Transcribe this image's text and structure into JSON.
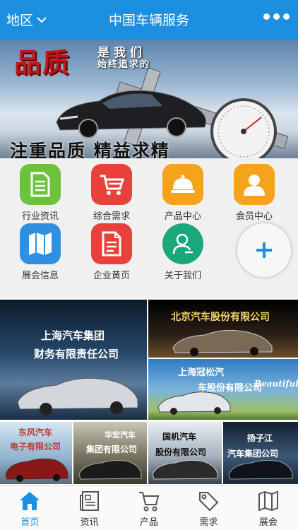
{
  "header": {
    "region_label": "地区",
    "title": "中国车辆服务"
  },
  "banner": {
    "headline": "品质",
    "tagline1": "是我们",
    "tagline2": "始终追求的",
    "slogan": "注重品质 精益求精"
  },
  "grid": {
    "items": [
      {
        "label": "行业资讯",
        "icon": "document-icon",
        "color": "#6cc33b"
      },
      {
        "label": "综合需求",
        "icon": "cart-icon",
        "color": "#e8413b"
      },
      {
        "label": "产品中心",
        "icon": "cloche-icon",
        "color": "#f5a31c"
      },
      {
        "label": "会员中心",
        "icon": "user-icon",
        "color": "#f5a31c"
      },
      {
        "label": "展会信息",
        "icon": "map-icon",
        "color": "#2f8fe0"
      },
      {
        "label": "企业黄页",
        "icon": "page-icon",
        "color": "#e8413b"
      },
      {
        "label": "关于我们",
        "icon": "person-icon",
        "color": "#19a87c"
      }
    ],
    "more_icon": "plus-icon"
  },
  "ads": {
    "a1_line1": "上海汽车集团",
    "a1_line2": "财务有限责任公司",
    "a2": "北京汽车股份有限公司",
    "a3_line1": "上海冠松汽",
    "a3_line2": "车股份有限公司",
    "a3_en": "Beautiful",
    "a4_line1": "东风汽车",
    "a4_line2": "电子有限公司",
    "a5_line1": "华宏汽车",
    "a5_line2": "集团有限公司",
    "a6_line1": "国机汽车",
    "a6_line2": "股份有限公司",
    "a7_line1": "扬子江",
    "a7_line2": "汽车集团公司"
  },
  "nav": {
    "items": [
      {
        "label": "首页",
        "icon": "home-icon",
        "active": true
      },
      {
        "label": "资讯",
        "icon": "newspaper-icon",
        "active": false
      },
      {
        "label": "产品",
        "icon": "cart-icon",
        "active": false
      },
      {
        "label": "需求",
        "icon": "tag-icon",
        "active": false
      },
      {
        "label": "展会",
        "icon": "map-icon",
        "active": false
      }
    ]
  },
  "colors": {
    "accent": "#1d8fe1",
    "green": "#6cc33b",
    "red": "#e8413b",
    "orange": "#f5a31c",
    "blue": "#2f8fe0",
    "teal": "#19a87c"
  }
}
